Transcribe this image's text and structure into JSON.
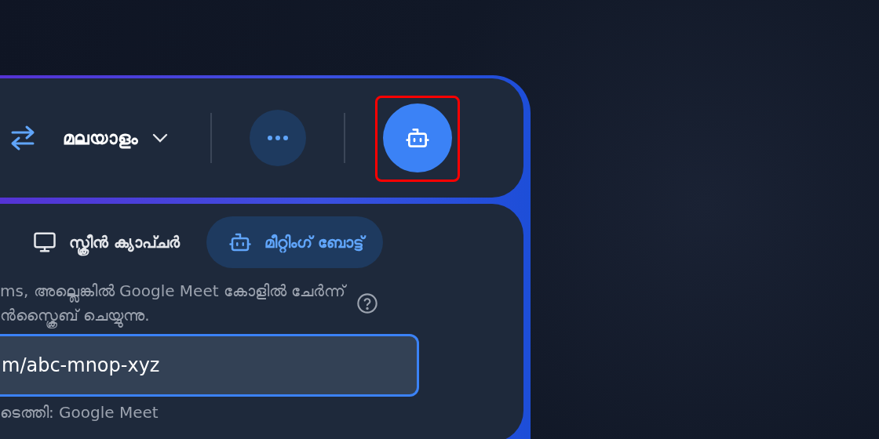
{
  "toolbar": {
    "language": "മലയാളം",
    "bot_button": {
      "highlighted": true
    }
  },
  "tabs": [
    {
      "label": "സ്ക്രീൻ ക്യാപ്ചർ",
      "selected": false
    },
    {
      "label": "മീറ്റിംഗ് ബോട്ട്",
      "selected": true
    }
  ],
  "description": [
    "ms, അല്ലെങ്കിൽ Google Meet കോളിൽ ചേർന്ന്",
    "ൻസ്ക്രൈബ് ചെയ്യുന്നു."
  ],
  "meeting_url": {
    "value": "m/abc-mnop-xyz",
    "focused": true
  },
  "detected": "ടെത്തി: Google Meet"
}
